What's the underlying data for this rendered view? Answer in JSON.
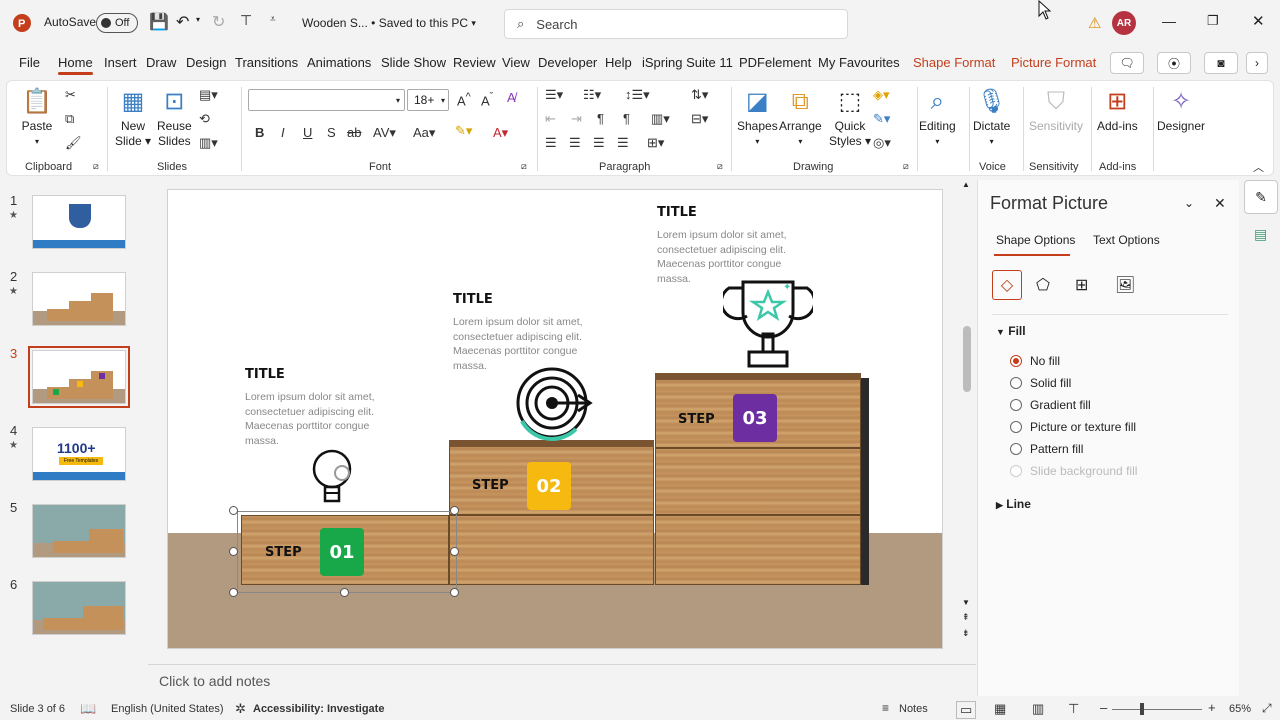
{
  "titlebar": {
    "autosave_label": "AutoSave",
    "autosave_state": "Off",
    "document_title": "Wooden S...  •  Saved to this PC",
    "search_placeholder": "Search",
    "user_initials": "AR"
  },
  "tabs": [
    "File",
    "Home",
    "Insert",
    "Draw",
    "Design",
    "Transitions",
    "Animations",
    "Slide Show",
    "Review",
    "View",
    "Developer",
    "Help",
    "iSpring Suite 11",
    "PDFelement",
    "My Favourites",
    "Shape Format",
    "Picture Format"
  ],
  "ribbon": {
    "clipboard": {
      "paste": "Paste",
      "group": "Clipboard"
    },
    "slides": {
      "new_slide_1": "New",
      "new_slide_2": "Slide",
      "reuse_1": "Reuse",
      "reuse_2": "Slides",
      "group": "Slides"
    },
    "font": {
      "font_name": "",
      "font_size": "18+",
      "group": "Font"
    },
    "paragraph": {
      "group": "Paragraph"
    },
    "drawing": {
      "shapes": "Shapes",
      "arrange": "Arrange",
      "quick_styles_1": "Quick",
      "quick_styles_2": "Styles",
      "group": "Drawing"
    },
    "editing": {
      "label": "Editing"
    },
    "voice": {
      "dictate": "Dictate",
      "group": "Voice"
    },
    "sensitivity": {
      "label": "Sensitivity",
      "group": "Sensitivity"
    },
    "addins": {
      "label": "Add-ins",
      "group": "Add-ins"
    },
    "designer": {
      "label": "Designer"
    }
  },
  "thumbnails": [
    {
      "num": "1",
      "star": "★"
    },
    {
      "num": "2",
      "star": "★"
    },
    {
      "num": "3",
      "star": ""
    },
    {
      "num": "4",
      "star": "★",
      "text": "1100+",
      "subtext": "Free Templates"
    },
    {
      "num": "5",
      "star": ""
    },
    {
      "num": "6",
      "star": ""
    }
  ],
  "slide": {
    "blocks": [
      {
        "title": "TITLE",
        "body": "Lorem ipsum dolor sit amet, consectetuer adipiscing elit. Maecenas porttitor congue massa.",
        "step_label": "STEP",
        "step_num": "01",
        "color": "#18a84a"
      },
      {
        "title": "TITLE",
        "body": "Lorem ipsum dolor sit amet, consectetuer adipiscing elit. Maecenas porttitor congue massa.",
        "step_label": "STEP",
        "step_num": "02",
        "color": "#f6b90f"
      },
      {
        "title": "TITLE",
        "body": "Lorem ipsum dolor sit amet, consectetuer adipiscing elit. Maecenas porttitor congue massa.",
        "step_label": "STEP",
        "step_num": "03",
        "color": "#6c2ea0"
      }
    ]
  },
  "notes_placeholder": "Click to add notes",
  "format_pane": {
    "title": "Format Picture",
    "tab_shape": "Shape Options",
    "tab_text": "Text Options",
    "section_fill": "Fill",
    "fill_options": [
      "No fill",
      "Solid fill",
      "Gradient fill",
      "Picture or texture fill",
      "Pattern fill",
      "Slide background fill"
    ],
    "section_line": "Line"
  },
  "statusbar": {
    "slide_info": "Slide 3 of 6",
    "language": "English (United States)",
    "accessibility": "Accessibility: Investigate",
    "notes": "Notes",
    "zoom": "65%"
  },
  "colors": {
    "accent": "#c43e1c"
  }
}
